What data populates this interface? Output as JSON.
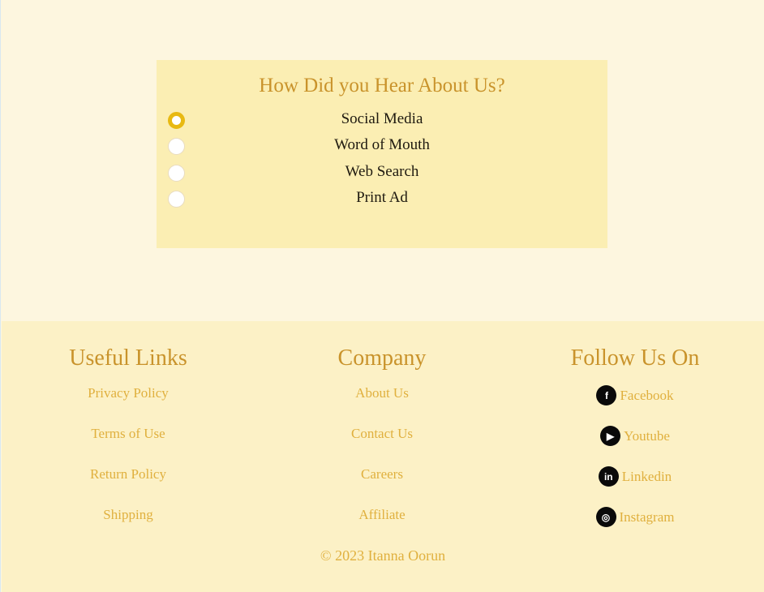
{
  "survey": {
    "title": "How Did you Hear About Us?",
    "options": [
      {
        "label": "Social Media",
        "checked": true
      },
      {
        "label": "Word of Mouth",
        "checked": false
      },
      {
        "label": "Web Search",
        "checked": false
      },
      {
        "label": "Print Ad",
        "checked": false
      }
    ]
  },
  "footer": {
    "useful_links": {
      "title": "Useful Links",
      "items": [
        "Privacy Policy",
        "Terms of Use",
        "Return Policy",
        "Shipping"
      ]
    },
    "company": {
      "title": "Company",
      "items": [
        "About Us",
        "Contact Us",
        "Careers",
        "Affiliate"
      ]
    },
    "follow": {
      "title": "Follow Us On",
      "items": [
        {
          "label": "Facebook",
          "icon": "facebook-icon"
        },
        {
          "label": "Youtube",
          "icon": "youtube-icon"
        },
        {
          "label": "Linkedin",
          "icon": "linkedin-icon"
        },
        {
          "label": "Instagram",
          "icon": "instagram-icon"
        }
      ]
    },
    "copyright": "© 2023 Itanna Oorun"
  },
  "colors": {
    "page_bg": "#fdf6df",
    "survey_bg": "#fbeeb3",
    "footer_bg": "#fcf1c6",
    "heading": "#c9932b",
    "link": "#e0b03e",
    "radio_checked": "#e8b912"
  }
}
